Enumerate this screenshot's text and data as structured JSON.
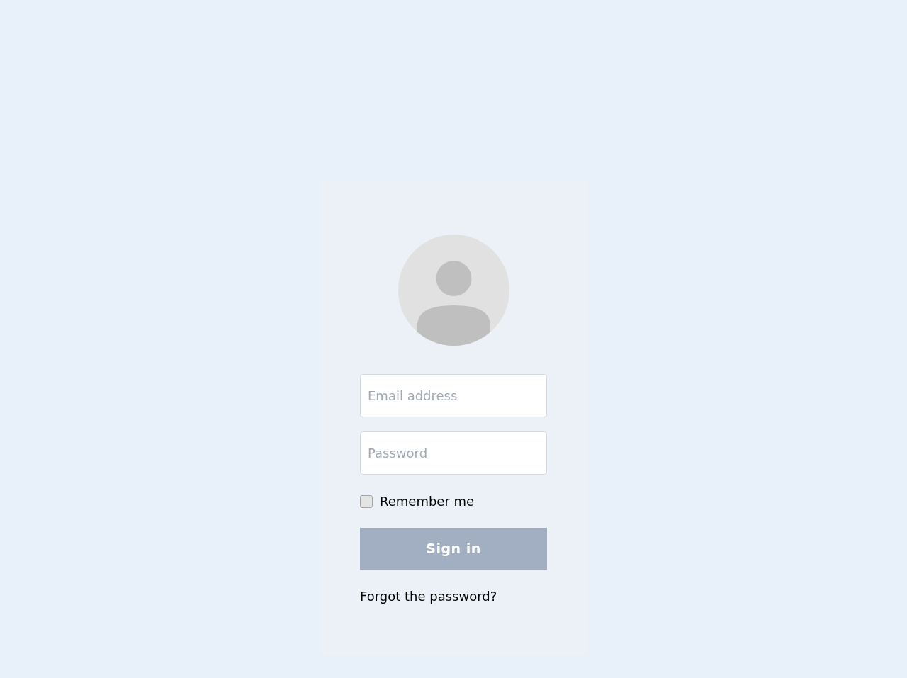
{
  "email": {
    "placeholder": "Email address"
  },
  "password": {
    "placeholder": "Password"
  },
  "remember": {
    "label": "Remember me",
    "checked": false
  },
  "sign_in": {
    "label": "Sign in"
  },
  "forgot_link": "Forgot the password?"
}
